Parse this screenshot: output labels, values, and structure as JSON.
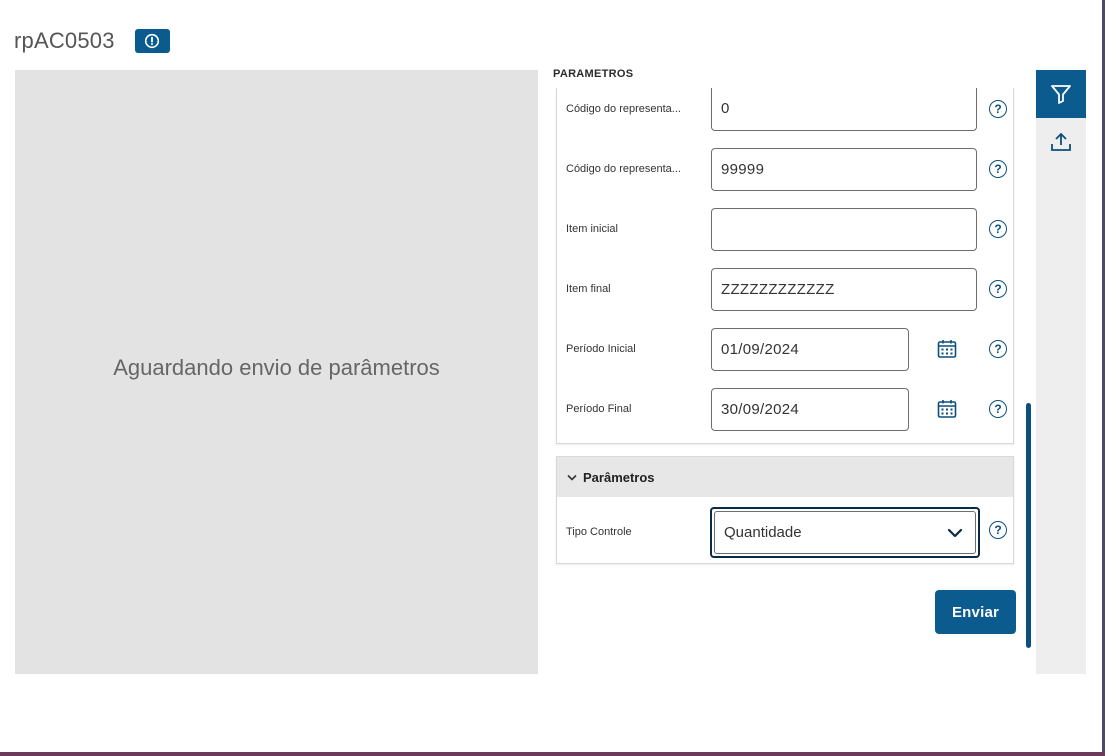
{
  "header": {
    "title": "rpAC0503",
    "info_icon": "info-circle-icon"
  },
  "preview": {
    "message": "Aguardando envio de parâmetros"
  },
  "parameters_section": {
    "label": "PARAMETROS",
    "fields": [
      {
        "label": "Código do representa...",
        "value": "0"
      },
      {
        "label": "Código do representa...",
        "value": "99999"
      },
      {
        "label": "Item inicial",
        "value": ""
      },
      {
        "label": "Item final",
        "value": "ZZZZZZZZZZZZ"
      },
      {
        "label": "Período Inicial",
        "value": "01/09/2024"
      },
      {
        "label": "Período Final",
        "value": "30/09/2024"
      }
    ],
    "help_glyph": "?"
  },
  "accordion": {
    "title": "Parâmetros",
    "expanded": true,
    "field": {
      "label": "Tipo Controle",
      "selected": "Quantidade"
    }
  },
  "actions": {
    "send_label": "Enviar"
  },
  "sidebar": {
    "filter_icon": "filter-icon",
    "upload_icon": "upload-icon"
  },
  "colors": {
    "primary": "#0c5b8f",
    "dark_focus": "#0b2a44",
    "preview_bg": "#e3e3e3"
  }
}
